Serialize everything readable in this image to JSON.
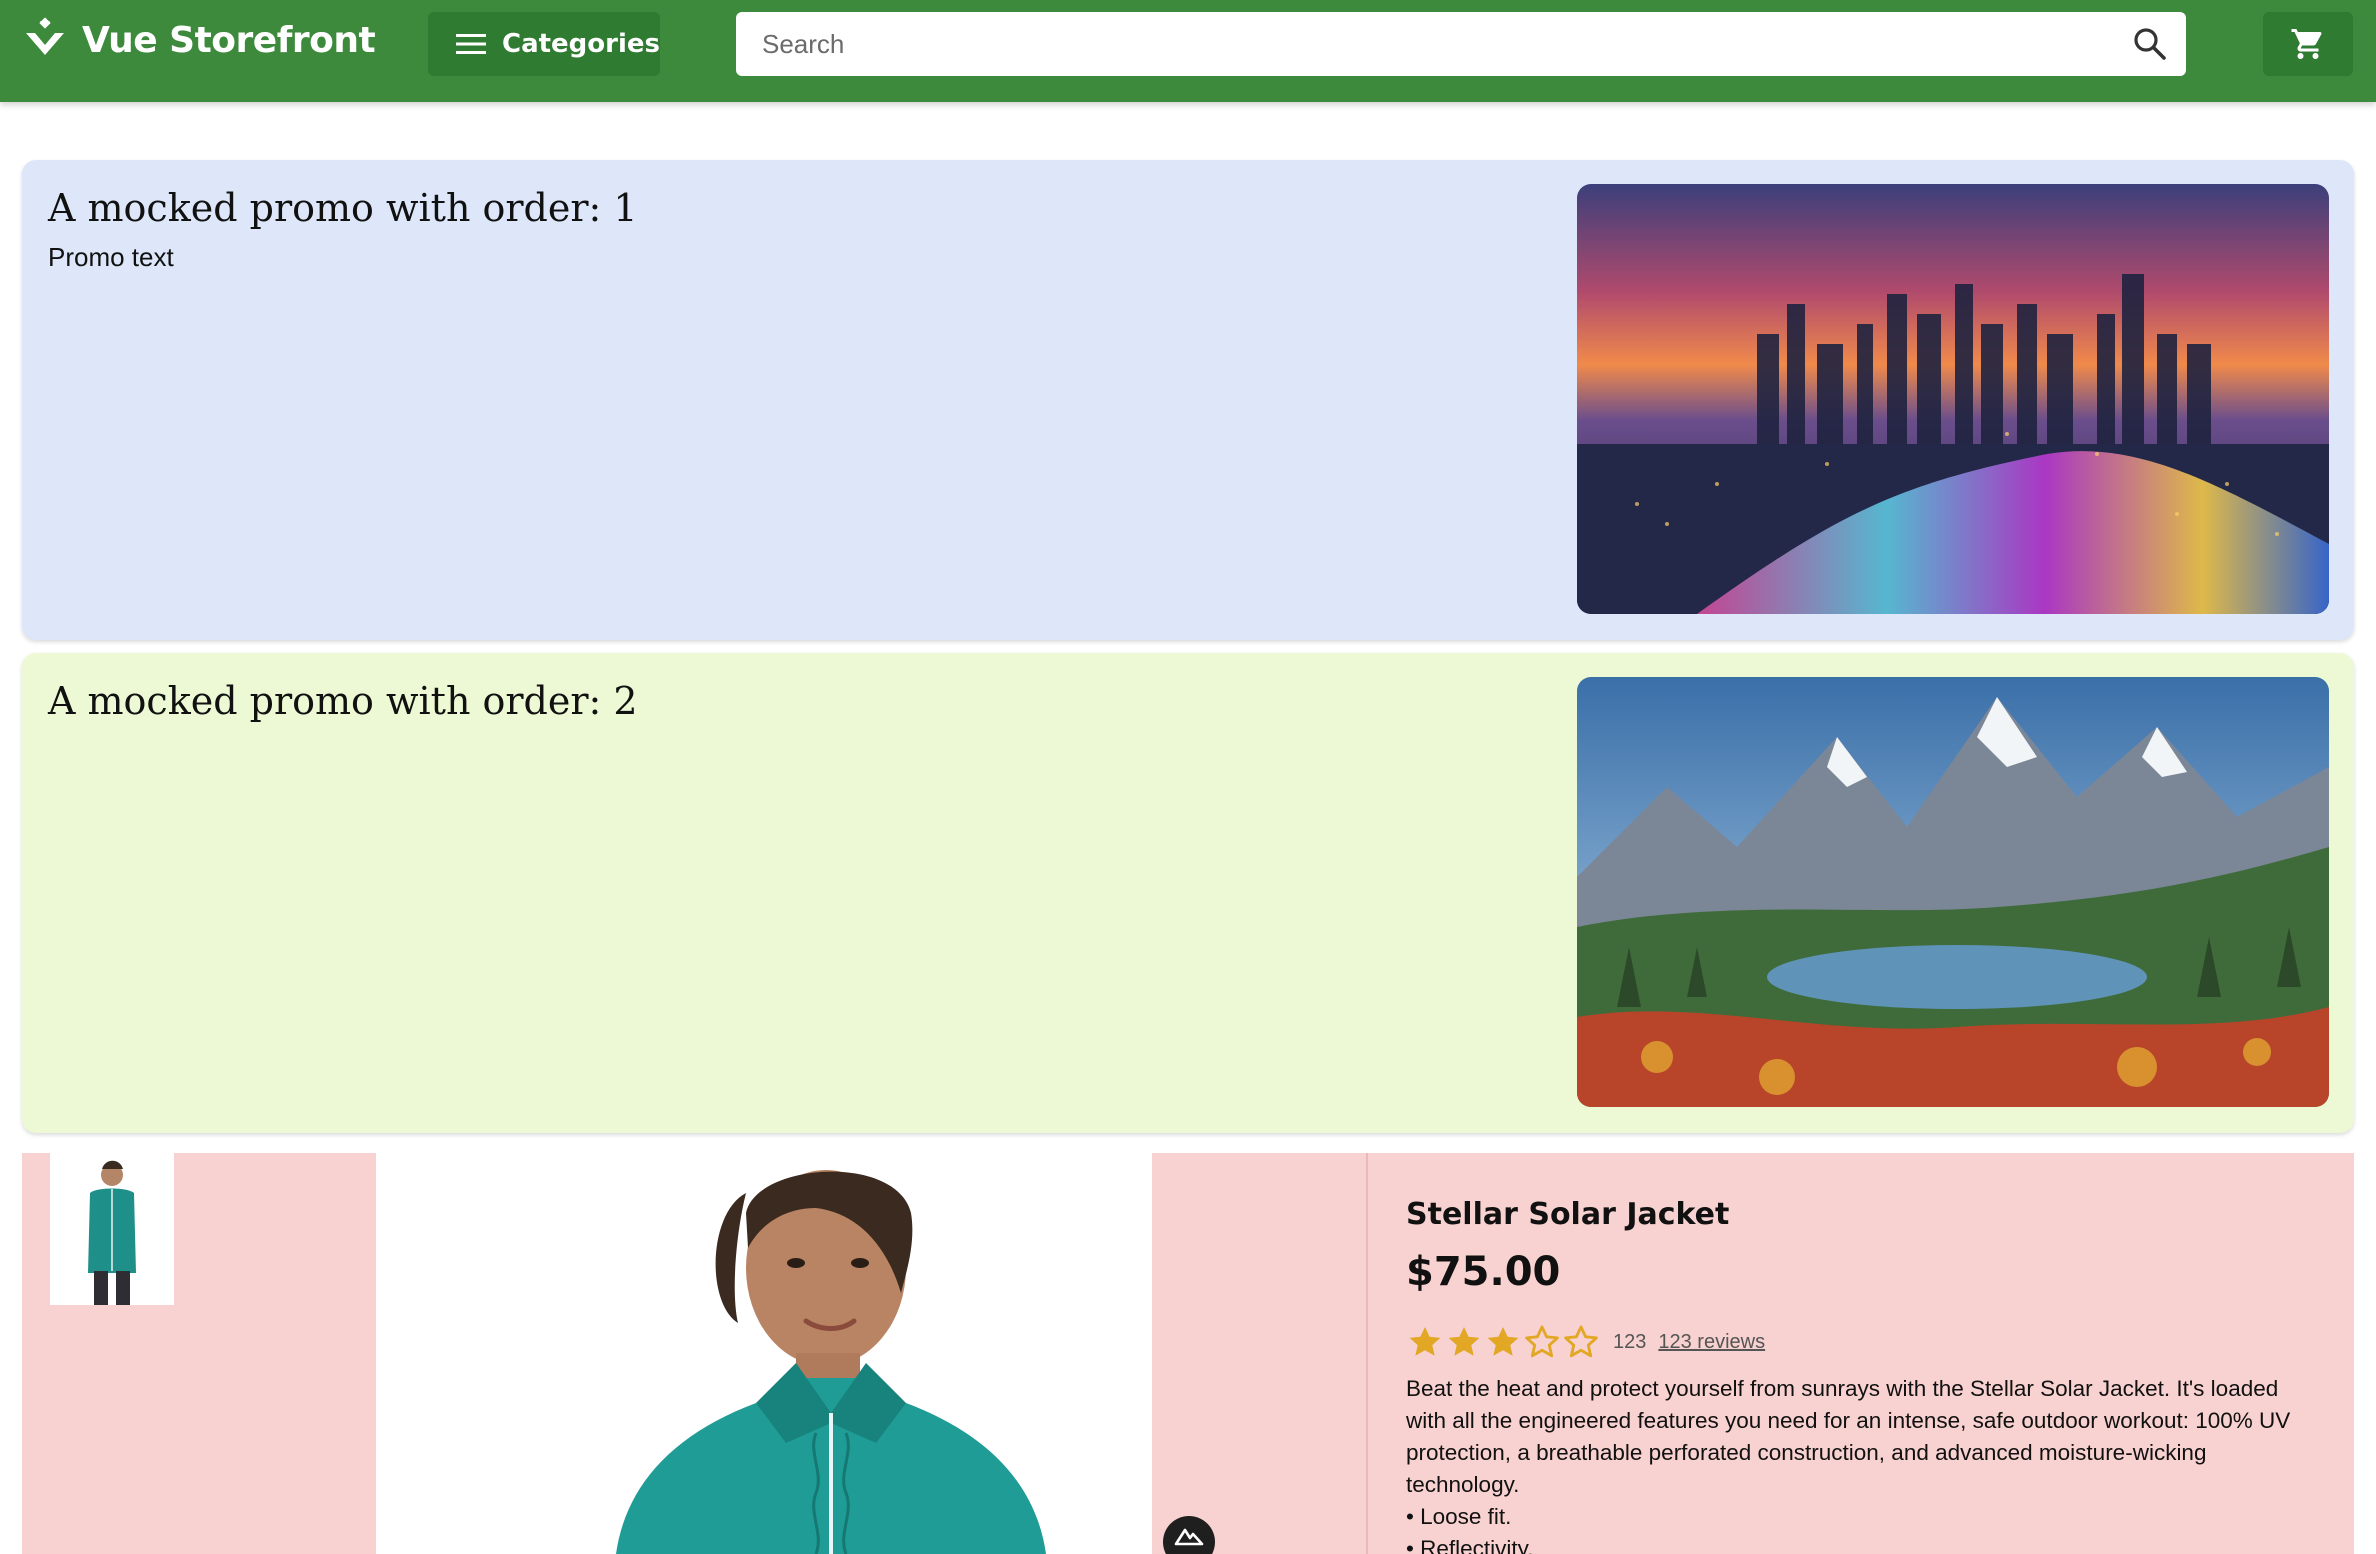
{
  "header": {
    "brand": "Vue Storefront",
    "categories_label": "Categories",
    "search_placeholder": "Search",
    "colors": {
      "primary": "#3d8a3c",
      "button": "#2f7b31"
    }
  },
  "promos": [
    {
      "title": "A mocked promo with order: 1",
      "text": "Promo text",
      "background": "#dde7f9",
      "image": "city-skyline-sunset"
    },
    {
      "title": "A mocked promo with order: 2",
      "text": "",
      "background": "#edf9d4",
      "image": "mountain-lake-landscape"
    }
  ],
  "product": {
    "name": "Stellar Solar Jacket",
    "price": "$75.00",
    "rating": 3,
    "rating_max": 5,
    "rating_count": "123",
    "reviews_label": "123 reviews",
    "description": "Beat the heat and protect yourself from sunrays with the Stellar Solar Jacket. It's loaded with all the engineered features you need for an intense, safe outdoor workout: 100% UV protection, a breathable perforated construction, and advanced moisture-wicking technology.",
    "bullets": [
      "• Loose fit.",
      "• Reflectivity."
    ],
    "panel_color": "#f8d2d0",
    "star_color": "#e2a725"
  }
}
